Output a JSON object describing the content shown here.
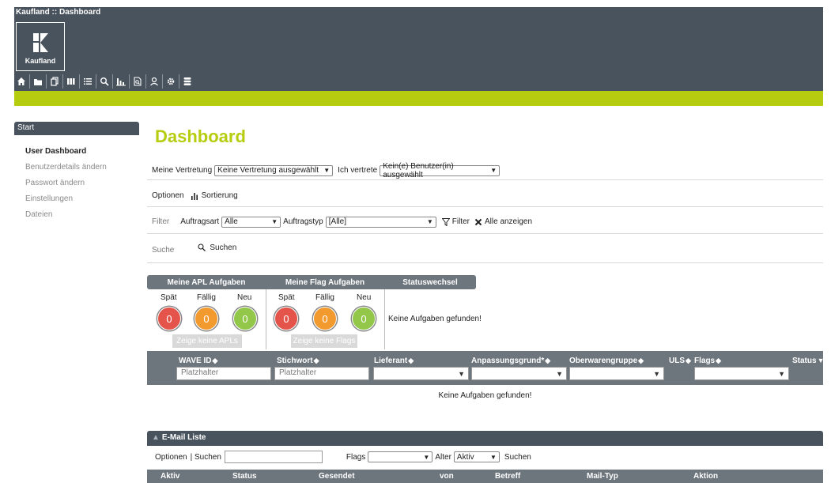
{
  "header": {
    "app_title": "Kaufland :: Dashboard",
    "logo_text": "Kaufland",
    "toolbar_icons": [
      "home-icon",
      "folder-icon",
      "copy-icon",
      "book-icon",
      "list-icon",
      "search-icon",
      "bar-chart-icon",
      "document-search-icon",
      "user-icon",
      "gear-icon",
      "database-icon"
    ],
    "colors": {
      "header_bg": "#49535e",
      "accent": "#b6cd0f"
    }
  },
  "sidebar": {
    "heading": "Start",
    "items": [
      {
        "label": "User Dashboard",
        "active": true
      },
      {
        "label": "Benutzerdetails ändern"
      },
      {
        "label": "Passwort ändern"
      },
      {
        "label": "Einstellungen"
      },
      {
        "label": "Dateien"
      }
    ]
  },
  "main": {
    "title": "Dashboard",
    "vertretung": {
      "label": "Meine Vertretung",
      "value": "Keine Vertretung ausgewählt",
      "ich_label": "Ich vertrete",
      "ich_value": "Kein(e) Benutzer(in) ausgewählt"
    },
    "options": {
      "label": "Optionen",
      "sort_label": "Sortierung"
    },
    "filter": {
      "label": "Filter",
      "auftragsart_label": "Auftragsart",
      "auftragsart_value": "Alle",
      "auftragstyp_label": "Auftragstyp",
      "auftragstyp_value": "[Alle]",
      "filter_button": "Filter",
      "show_all_button": "Alle anzeigen"
    },
    "search": {
      "label": "Suche",
      "button": "Suchen"
    }
  },
  "tasks": {
    "tabs": [
      "Meine APL Aufgaben",
      "Meine Flag Aufgaben",
      "Statuswechsel"
    ],
    "apl": {
      "labels": [
        "Spät",
        "Fällig",
        "Neu"
      ],
      "counts": [
        "0",
        "0",
        "0"
      ],
      "button": "Zeige keine APLs"
    },
    "flags": {
      "labels": [
        "Spät",
        "Fällig",
        "Neu"
      ],
      "counts": [
        "0",
        "0",
        "0"
      ],
      "button": "Zeige keine Flags"
    },
    "status_empty": "Keine Aufgaben gefunden!"
  },
  "wave_table": {
    "columns": [
      "WAVE ID",
      "Stichwort",
      "Lieferant",
      "Anpassungsgrund*",
      "Oberwarengruppe",
      "ULS",
      "Flags",
      "Status"
    ],
    "placeholders": {
      "wave_id": "Platzhalter",
      "stichwort": "Platzhalter"
    },
    "empty": "Keine Aufgaben gefunden!"
  },
  "mail": {
    "title": "E-Mail Liste",
    "options_label": "Optionen",
    "search_label": "| Suchen",
    "flags_label": "Flags",
    "alter_label": "Alter",
    "alter_value": "Aktiv",
    "search_button": "Suchen",
    "columns": [
      "Aktiv",
      "Status",
      "Gesendet",
      "von",
      "Betreff",
      "Mail-Typ",
      "Aktion"
    ]
  }
}
